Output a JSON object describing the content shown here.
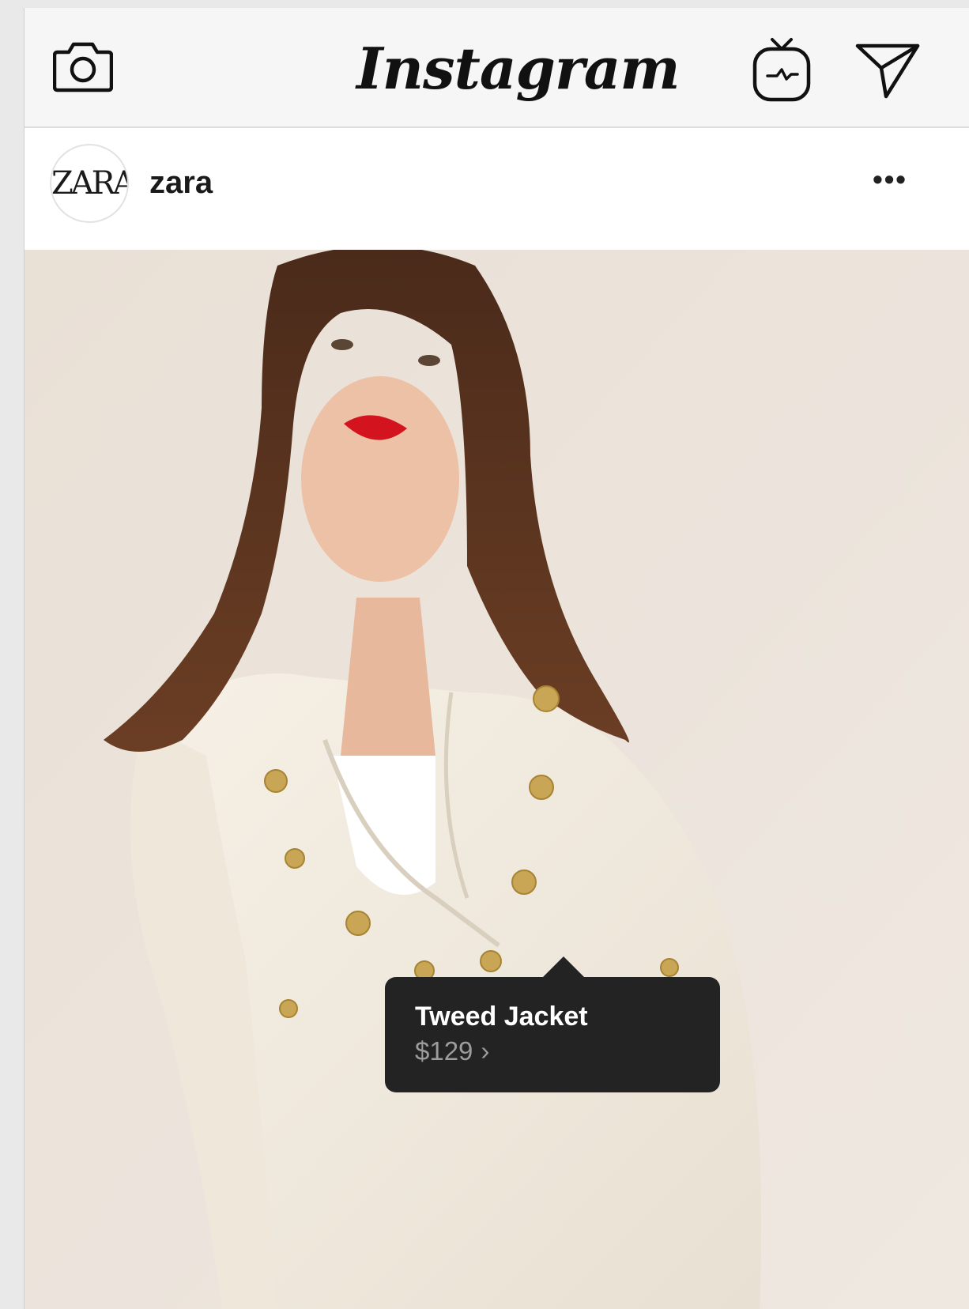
{
  "app": {
    "logo_text": "Instagram"
  },
  "topbar": {
    "icons": [
      "camera-icon",
      "igtv-icon",
      "direct-message-icon"
    ]
  },
  "post": {
    "avatar_text": "ZARA",
    "username": "zara",
    "more_label": "•••"
  },
  "product_tag": {
    "name": "Tweed Jacket",
    "price": "$129",
    "chevron": "›"
  },
  "colors": {
    "topbar_bg": "#f6f6f6",
    "tag_bg": "#232323",
    "tag_price": "#9c9c9c",
    "photo_bg": "#ece4dc"
  }
}
